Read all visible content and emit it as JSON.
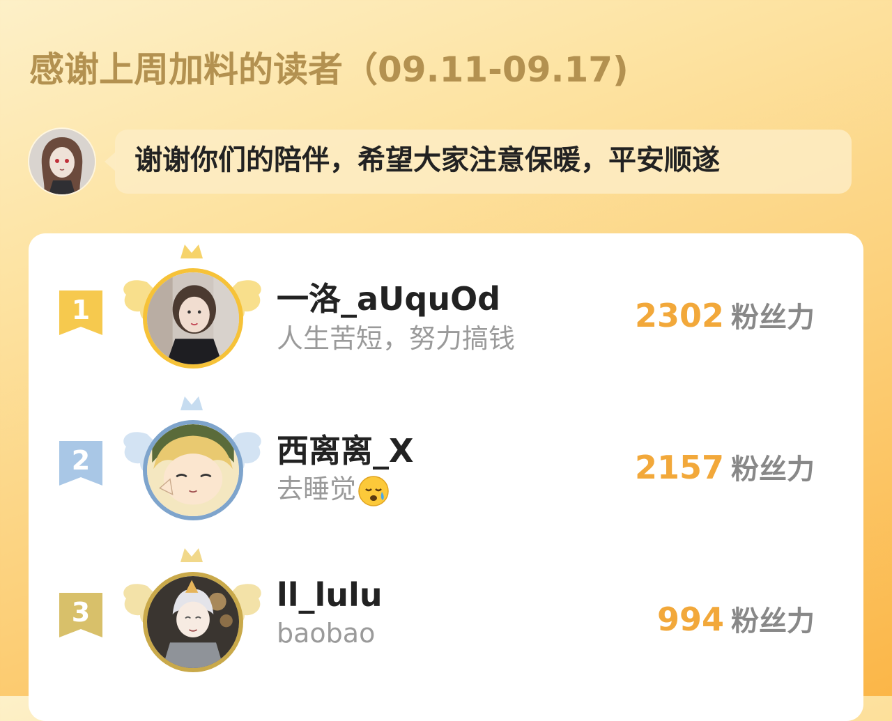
{
  "header": {
    "title": "感谢上周加料的读者（09.11-09.17)"
  },
  "author": {
    "message": "谢谢你们的陪伴，希望大家注意保暖，平安顺遂"
  },
  "leaderboard": {
    "unit": "粉丝力",
    "entries": [
      {
        "rank": "1",
        "name": "一洛_aUquOd",
        "bio": "人生苦短，努力搞钱",
        "score": "2302",
        "medal": "gold",
        "medal_color": "#f6c94e",
        "ring_color": "#f6c238"
      },
      {
        "rank": "2",
        "name": "西离离_X",
        "bio": "去睡觉",
        "bio_emoji": "sleepy-face-emoji",
        "score": "2157",
        "medal": "silver",
        "medal_color": "#a9c7e6",
        "ring_color": "#7ea4cc"
      },
      {
        "rank": "3",
        "name": "ll_lulu",
        "bio": "baobao",
        "score": "994",
        "medal": "bronze",
        "medal_color": "#d8c06a",
        "ring_color": "#c9a94a"
      }
    ]
  },
  "colors": {
    "title": "#b39150",
    "score": "#f2a83a",
    "background_top": "#fdf0c8",
    "background_bottom": "#fbb648"
  }
}
